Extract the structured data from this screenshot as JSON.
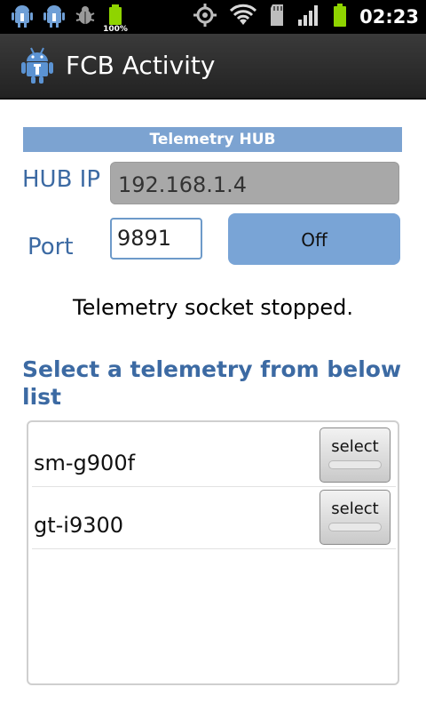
{
  "status_bar": {
    "battery_percent": "100%",
    "time": "02:23",
    "icons_left": [
      "android-debug-icon",
      "android-usb-icon",
      "bug-icon",
      "battery-full-icon"
    ],
    "icons_right": [
      "gps-icon",
      "wifi-icon",
      "sd-card-icon",
      "signal-icon",
      "battery-icon"
    ]
  },
  "title_bar": {
    "app_title": "FCB Activity",
    "icon": "android-robot-icon"
  },
  "hub": {
    "section_title": "Telemetry HUB",
    "ip_label": "HUB IP",
    "ip_value": "192.168.1.4",
    "port_label": "Port",
    "port_value": "9891",
    "toggle_label": "Off"
  },
  "socket_status": "Telemetry socket stopped.",
  "telemetry_list": {
    "heading": "Select a telemetry from below list",
    "items": [
      {
        "label": "sm-g900f",
        "button": "select"
      },
      {
        "label": "gt-i9300",
        "button": "select"
      }
    ]
  },
  "colors": {
    "accent": "#7ca3d1",
    "label_blue": "#3c6aa3",
    "button_blue": "#79a4d6"
  }
}
